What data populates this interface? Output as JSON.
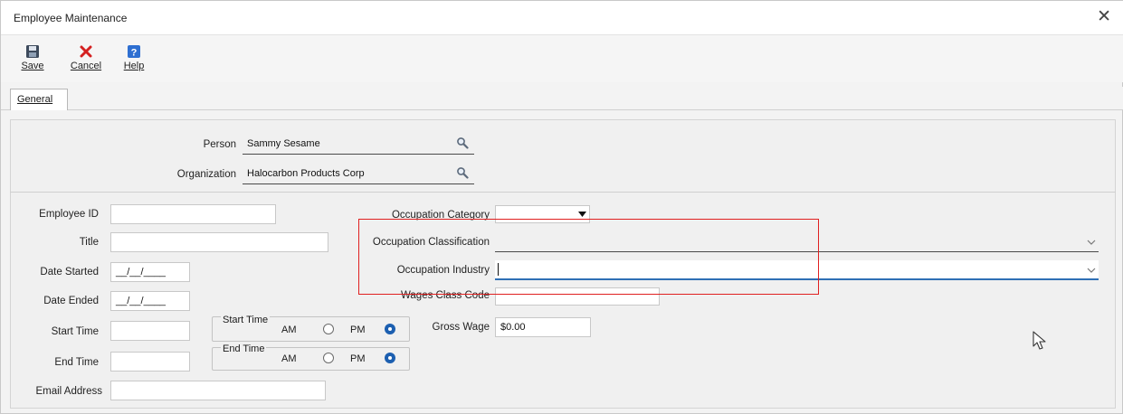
{
  "window": {
    "title": "Employee Maintenance",
    "close_glyph": "✕"
  },
  "toolbar": {
    "save": {
      "label": "Save",
      "icon": "save-disk-icon"
    },
    "cancel": {
      "label": "Cancel",
      "icon": "red-x-icon"
    },
    "help": {
      "label": "Help",
      "icon": "help-question-icon"
    }
  },
  "tabs": [
    {
      "label": "General",
      "active": true
    }
  ],
  "person": {
    "label": "Person",
    "value": "Sammy  Sesame",
    "lookup_icon": "magnifier-icon"
  },
  "organization": {
    "label": "Organization",
    "value": "Halocarbon Products Corp",
    "lookup_icon": "magnifier-icon"
  },
  "left_fields": {
    "employee_id": {
      "label": "Employee ID",
      "value": ""
    },
    "title": {
      "label": "Title",
      "value": ""
    },
    "date_started": {
      "label": "Date Started",
      "value": "__/__/____"
    },
    "date_ended": {
      "label": "Date Ended",
      "value": "__/__/____"
    },
    "start_time": {
      "label": "Start Time",
      "value": ""
    },
    "end_time": {
      "label": "End Time",
      "value": ""
    },
    "email": {
      "label": "Email Address",
      "value": ""
    }
  },
  "start_time_group": {
    "caption": "Start Time",
    "am": "AM",
    "pm": "PM",
    "selected": "PM"
  },
  "end_time_group": {
    "caption": "End Time",
    "am": "AM",
    "pm": "PM",
    "selected": "PM"
  },
  "right_fields": {
    "occupation_category": {
      "label": "Occupation Category",
      "value": ""
    },
    "occupation_classification": {
      "label": "Occupation Classification",
      "value": ""
    },
    "occupation_industry": {
      "label": "Occupation Industry",
      "value": ""
    },
    "wages_class_code": {
      "label": "Wages Class Code",
      "value": ""
    },
    "gross_wage": {
      "label": "Gross Wage",
      "value": "$0.00"
    }
  },
  "colors": {
    "highlight_box": "#e02020",
    "focus_underline": "#2f6fb5",
    "radio_selected": "#1c5fb0"
  }
}
